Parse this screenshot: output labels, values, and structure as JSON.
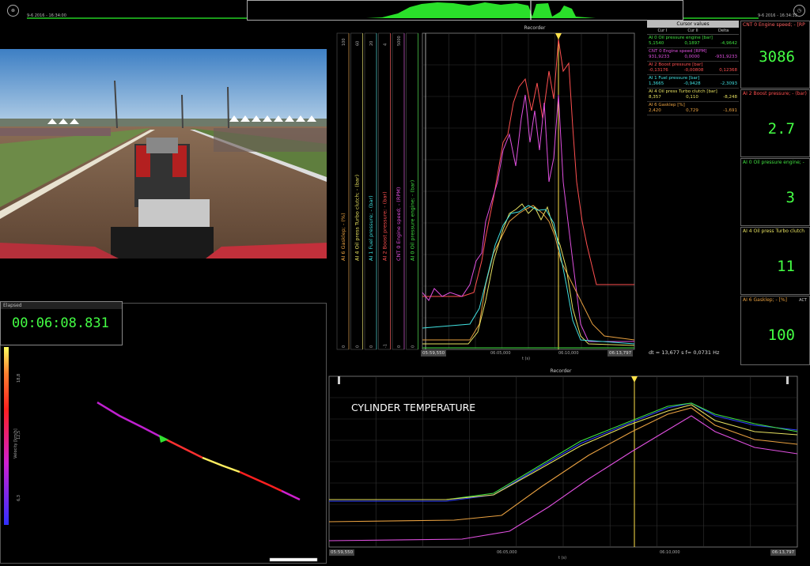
{
  "topbar": {
    "left_time": "9-6 2016 - 16:34:00",
    "right_time": "9-6 2016 - 16:34:33"
  },
  "video": {
    "description_icon": "video-frame"
  },
  "recorder1": {
    "title": "Recorder",
    "x_start": "05:59,550",
    "x_end": "06:13,797",
    "x_mid1": "06:05,000",
    "x_mid2": "06:10,000",
    "x_unit": "t (s)",
    "axes": [
      {
        "label": "AI 6 Gasklep; - (%)",
        "top": "100",
        "bottom": "0",
        "color": "#e8a040"
      },
      {
        "label": "AI 4 Oil press Turbo clutch; - (bar)",
        "top": "60",
        "bottom": "0",
        "color": "#e6e060"
      },
      {
        "label": "AI 1 Fuel pressure; - (bar)",
        "top": "20",
        "bottom": "0",
        "color": "#40e0e0"
      },
      {
        "label": "AI 2 Boost pressure; - (bar)",
        "top": "4",
        "bottom": "-1",
        "color": "#ff5050"
      },
      {
        "label": "CNT 0 Engine speed; - (RPM)",
        "top": "5000",
        "bottom": "0",
        "color": "#e050e0"
      },
      {
        "label": "AI 0 Oil pressure engine; - (bar)",
        "top": "",
        "bottom": "0",
        "color": "#40e040"
      }
    ]
  },
  "cursor_values": {
    "title": "Cursor values",
    "cols": [
      "Cur I",
      "Cur II",
      "Delta"
    ],
    "rows": [
      {
        "name": "AI 0 Oil pressure engine [bar]",
        "v1": "5,1540",
        "v2": "0,1897",
        "v3": "-4,9642",
        "color": "#40e040"
      },
      {
        "name": "CNT 0 Engine speed [RPM]",
        "v1": "931,9233",
        "v2": "0,0000",
        "v3": "-931,9233",
        "color": "#e050e0"
      },
      {
        "name": "AI 2 Boost pressure [bar]",
        "v1": "-0,13176",
        "v2": "-0,00808",
        "v3": "0,12368",
        "color": "#ff5050"
      },
      {
        "name": "AI 1 Fuel pressure [bar]",
        "v1": "1,3665",
        "v2": "-0,9428",
        "v3": "-2,3093",
        "color": "#40e0e0"
      },
      {
        "name": "AI 4 Oil press Turbo clutch [bar]",
        "v1": "8,357",
        "v2": "0,110",
        "v3": "-8,248",
        "color": "#e6e060"
      },
      {
        "name": "AI 6 Gasklep [%]",
        "v1": "2,420",
        "v2": "0,729",
        "v3": "-1,691",
        "color": "#e8a040"
      }
    ]
  },
  "dt_info": "dt = 13,677 s   f= 0,0731 Hz",
  "gauges": [
    {
      "label": "CNT 0 Engine speed; - [RP",
      "value": "3086",
      "color": "#ff6060"
    },
    {
      "label": "AI 2 Boost pressure; - (bar)",
      "value": "2.7",
      "color": "#ff5050"
    },
    {
      "label": "AI 0 Oil pressure engine; -",
      "value": "3",
      "color": "#40e040"
    },
    {
      "label": "AI 4 Oil press Turbo clutch",
      "value": "11",
      "color": "#e6e060"
    },
    {
      "label": "AI 6 Gasklep; - [%]",
      "value": "100",
      "color": "#e8a040",
      "badge": "ACT"
    }
  ],
  "elapsed": {
    "label": "Elapsed",
    "value": "00:06:08.831"
  },
  "track": {
    "scale_ticks": [
      "18,8",
      "12,5",
      "6,3"
    ],
    "scale_label": "Velocity [km/h]"
  },
  "recorder2": {
    "title": "Recorder",
    "heading": "CYLINDER TEMPERATURE",
    "x_start": "05:59,550",
    "x_end": "06:13,797",
    "x_mid1": "06:05,000",
    "x_mid2": "06:10,000",
    "x_unit": "t (s)"
  },
  "colors": {
    "accent_green": "#4f4",
    "cursor_yellow": "#ffe24a"
  }
}
